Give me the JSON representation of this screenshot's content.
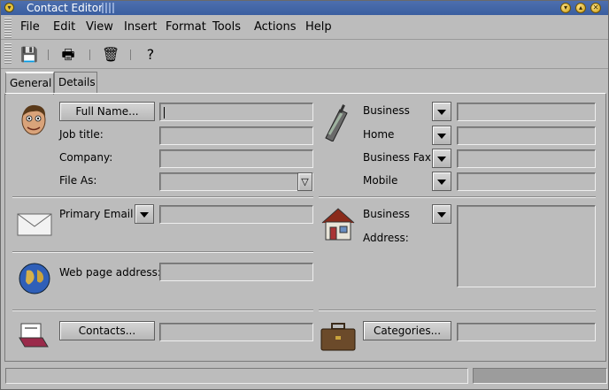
{
  "window": {
    "title": "Contact Editor",
    "buttons": [
      "minimize-icon",
      "maximize-icon",
      "close-icon"
    ]
  },
  "menubar": {
    "items": [
      {
        "label": "File"
      },
      {
        "label": "Edit"
      },
      {
        "label": "View"
      },
      {
        "label": "Insert"
      },
      {
        "label": "Format"
      },
      {
        "label": "Tools"
      },
      {
        "label": "Actions"
      },
      {
        "label": "Help"
      }
    ]
  },
  "toolbar": {
    "icons": [
      "save-icon",
      "print-icon",
      "delete-icon",
      "help-icon"
    ],
    "glyphs": [
      "💾",
      "🖶",
      "🗑",
      "?"
    ]
  },
  "tabs": [
    {
      "label": "General"
    },
    {
      "label": "Details"
    }
  ],
  "general": {
    "full_name_button": "Full Name...",
    "job_title_label": "Job title:",
    "company_label": "Company:",
    "file_as_label": "File As:",
    "file_as_dropdown": "▽",
    "primary_email_label": "Primary Email",
    "web_page_label": "Web page address:",
    "contacts_button": "Contacts...",
    "phones": [
      {
        "label": "Business"
      },
      {
        "label": "Home"
      },
      {
        "label": "Business Fax"
      },
      {
        "label": "Mobile"
      }
    ],
    "address_type": "Business",
    "address_label": "Address:",
    "categories_button": "Categories..."
  },
  "colors": {
    "titlebar": "#3a5ea0",
    "background": "#bcbcbc"
  }
}
